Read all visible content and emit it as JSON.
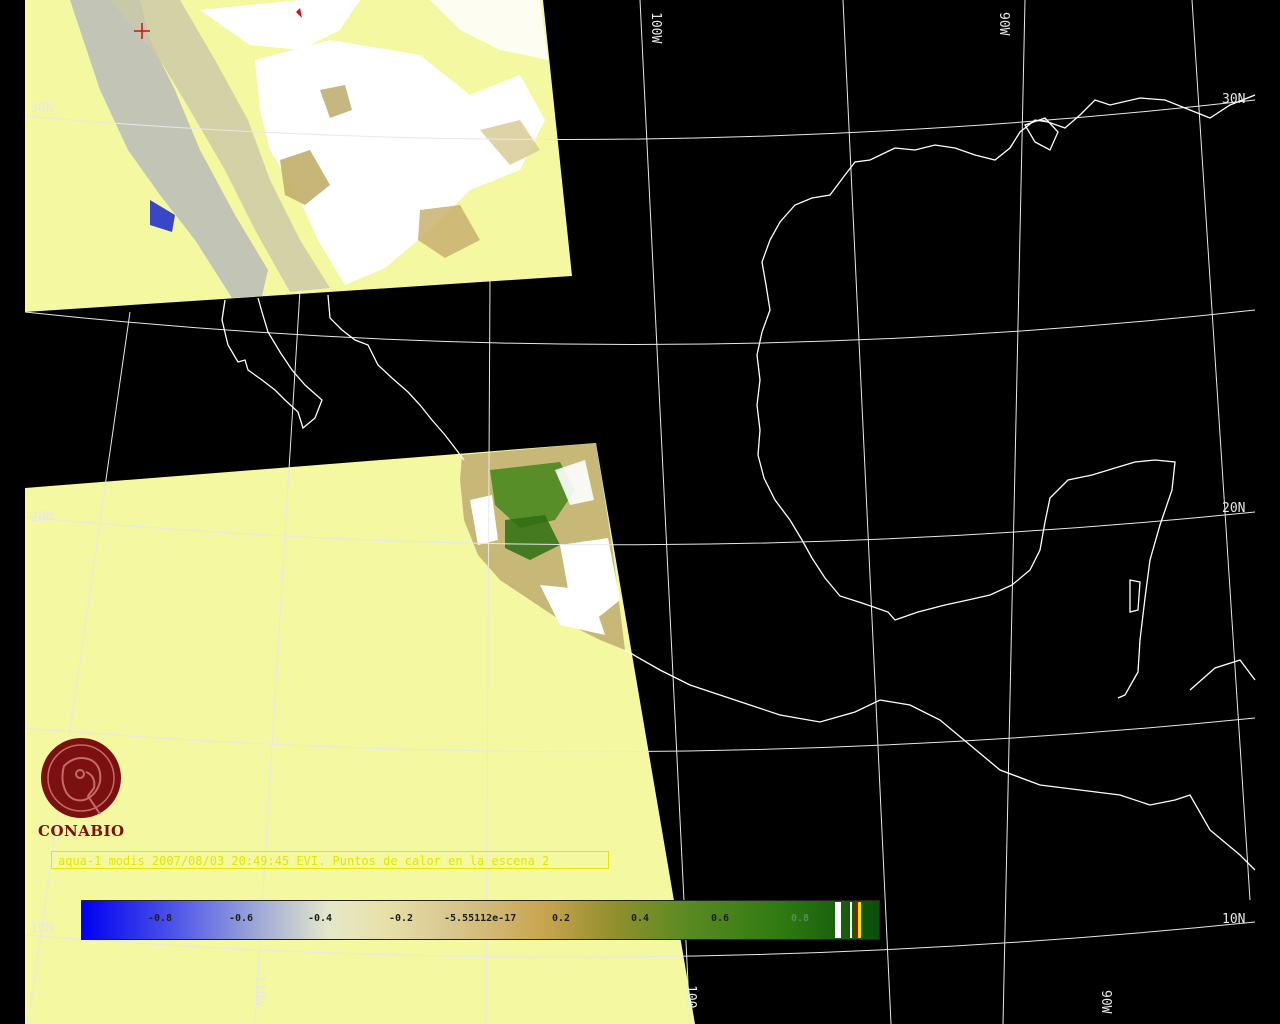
{
  "grid_labels": {
    "lon_100w_top": "100W",
    "lon_90w_top": "90W",
    "lat_30n_right": "30N",
    "lat_30n_left": "30N",
    "lat_20n_right": "20N",
    "lat_20n_left": "20N",
    "lat_10n_right": "10N",
    "lat_10n_left": "10N",
    "lon_110w_bottom": "110W",
    "lon_100w_bottom": "100",
    "lon_90w_bottom": "90W"
  },
  "caption": "aqua-1 modis 2007/08/03 20:49:45 EVI. Puntos de calor en la escena 2",
  "logo_text": "CONABIO",
  "colorbar": {
    "ticks": [
      "-0.8",
      "-0.6",
      "-0.4",
      "-0.2",
      "-5.55112e-17",
      "0.2",
      "0.4",
      "0.6",
      "0.8"
    ]
  },
  "colors": {
    "background": "#000000",
    "no_data_fill": "#f4f8a0",
    "cloud": "#ffffff",
    "caption": "#e5e500",
    "logo": "#7a1010",
    "hotspot_marker": "#d01010"
  }
}
